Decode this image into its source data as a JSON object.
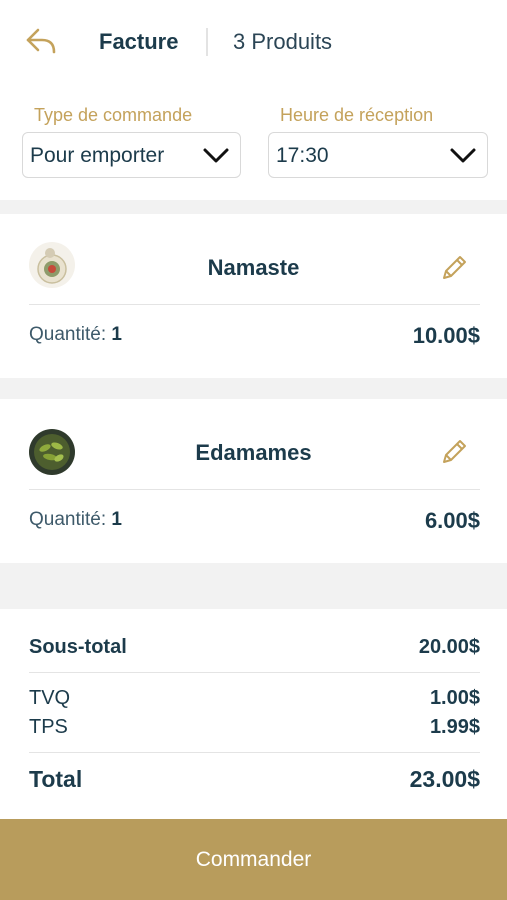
{
  "header": {
    "title": "Facture",
    "product_count": "3 Produits"
  },
  "order": {
    "type_label": "Type de commande",
    "type_value": "Pour emporter",
    "time_label": "Heure de réception",
    "time_value": "17:30"
  },
  "items": [
    {
      "name": "Namaste",
      "qty_label": "Quantité: ",
      "qty": "1",
      "price": "10.00$"
    },
    {
      "name": "Edamames",
      "qty_label": "Quantité: ",
      "qty": "1",
      "price": "6.00$"
    }
  ],
  "totals": {
    "subtotal_label": "Sous-total",
    "subtotal": "20.00$",
    "tvq_label": "TVQ",
    "tvq": "1.00$",
    "tps_label": "TPS",
    "tps": "1.99$",
    "total_label": "Total",
    "total": "23.00$"
  },
  "footer": {
    "order_button": "Commander"
  },
  "colors": {
    "accent": "#b89c5c",
    "text": "#1c3b4b",
    "label": "#c4a25b"
  }
}
